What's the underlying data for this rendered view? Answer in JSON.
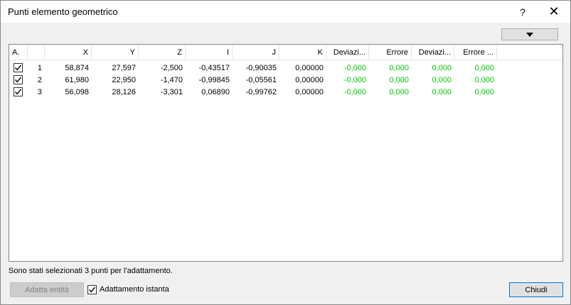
{
  "window": {
    "title": "Punti elemento geometrico",
    "help_label": "?",
    "close_glyph": "✕"
  },
  "table": {
    "columns": [
      "A.",
      "",
      "X",
      "Y",
      "Z",
      "I",
      "J",
      "K",
      "Deviazi...",
      "Errore",
      "Deviazi...",
      "Errore ..."
    ],
    "rows": [
      {
        "checked": true,
        "id": "1",
        "x": "58,874",
        "y": "27,597",
        "z": "-2,500",
        "i": "-0,43517",
        "j": "-0,90035",
        "k": "0,00000",
        "dev1": "-0,000",
        "err1": "0,000",
        "dev2": "0,000",
        "err2": "0,000"
      },
      {
        "checked": true,
        "id": "2",
        "x": "61,980",
        "y": "22,950",
        "z": "-1,470",
        "i": "-0,99845",
        "j": "-0,05561",
        "k": "0,00000",
        "dev1": "-0,000",
        "err1": "0,000",
        "dev2": "0,000",
        "err2": "0,000"
      },
      {
        "checked": true,
        "id": "3",
        "x": "56,098",
        "y": "28,126",
        "z": "-3,301",
        "i": "0,06890",
        "j": "-0,99762",
        "k": "0,00000",
        "dev1": "-0,000",
        "err1": "0,000",
        "dev2": "0,000",
        "err2": "0,000"
      }
    ]
  },
  "status_text": "Sono stati selezionati 3 punti per l'adattamento.",
  "buttons": {
    "fit_entity": "Adatta entità",
    "instant_fit": "Adattamento istanta",
    "close": "Chiudi"
  },
  "colors": {
    "deviation_green": "#00cc00",
    "accent_blue": "#0078d7"
  },
  "icons": {
    "dropdown": "triangle-down-icon",
    "check": "checkmark-icon"
  }
}
